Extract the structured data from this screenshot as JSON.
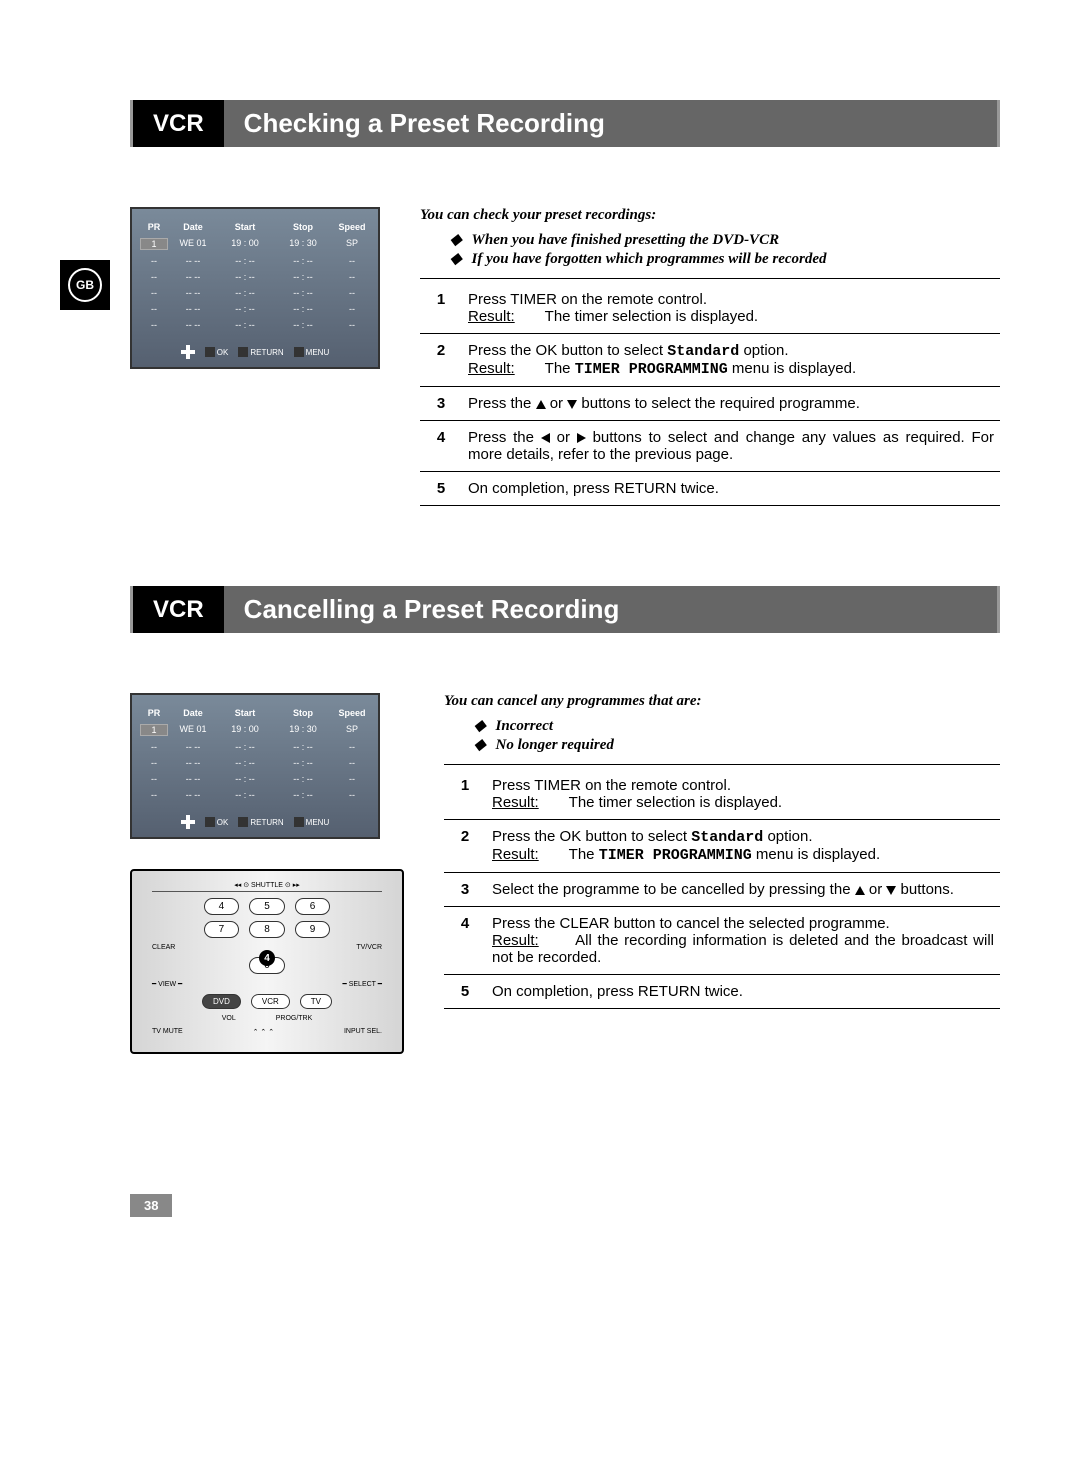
{
  "gb_label": "GB",
  "section1": {
    "vcr_tag": "VCR",
    "title": "Checking a Preset Recording",
    "osd": {
      "headers": [
        "PR",
        "Date",
        "Start",
        "Stop",
        "Speed"
      ],
      "row1": [
        "1",
        "WE  01",
        "19 : 00",
        "19 : 30",
        "SP"
      ],
      "blank": [
        "--",
        "--  --",
        "-- : --",
        "-- : --",
        "--"
      ],
      "footer": {
        "ok": "OK",
        "return": "RETURN",
        "menu": "MENU"
      }
    },
    "intro": "You can check your preset recordings:",
    "bullets": [
      "When you have finished presetting the DVD-VCR",
      "If you have forgotten which programmes will be recorded"
    ],
    "steps": [
      {
        "n": "1",
        "text": "Press TIMER on the remote control.",
        "result_label": "Result",
        "result": "The timer selection is displayed."
      },
      {
        "n": "2",
        "text": "Press the OK button to select ",
        "mono": "Standard",
        "text2": " option.",
        "result_label": "Result",
        "result_prefix": "The ",
        "result_mono": "TIMER PROGRAMMING",
        "result_suffix": " menu is displayed."
      },
      {
        "n": "3",
        "text_full": "Press the ▲ or ▼ buttons to select the required programme."
      },
      {
        "n": "4",
        "text_full": "Press the ◀ or ▶ buttons to select and change any values as required. For more details, refer to the previous page."
      },
      {
        "n": "5",
        "text_full": "On completion, press RETURN twice."
      }
    ]
  },
  "section2": {
    "vcr_tag": "VCR",
    "title": "Cancelling a Preset Recording",
    "intro": "You can cancel any programmes that are:",
    "bullets": [
      "Incorrect",
      "No longer required"
    ],
    "steps": [
      {
        "n": "1",
        "text": "Press TIMER on the remote control.",
        "result_label": "Result",
        "result": "The timer selection is displayed."
      },
      {
        "n": "2",
        "text": "Press the OK button to select ",
        "mono": "Standard",
        "text2": " option.",
        "result_label": "Result",
        "result_prefix": "The ",
        "result_mono": "TIMER PROGRAMMING",
        "result_suffix": " menu is displayed."
      },
      {
        "n": "3",
        "text_full": "Select the programme to be cancelled by pressing the ▲ or ▼ buttons."
      },
      {
        "n": "4",
        "text": "Press the CLEAR button to cancel the selected programme.",
        "result_label": "Result",
        "result": "All the recording information is deleted and the broadcast will not be recorded."
      },
      {
        "n": "5",
        "text_full": "On completion, press RETURN twice."
      }
    ],
    "remote": {
      "shuttle": "SHUTTLE",
      "nums_row1": [
        "4",
        "5",
        "6"
      ],
      "nums_row2": [
        "7",
        "8",
        "9"
      ],
      "clear": "CLEAR",
      "tvvcr": "TV/VCR",
      "zero": "0",
      "callout": "4",
      "view": "VIEW",
      "select": "SELECT",
      "dvd": "DVD",
      "vcr": "VCR",
      "tv": "TV",
      "vol": "VOL",
      "prog": "PROG/TRK",
      "tvmute": "TV MUTE",
      "inputsel": "INPUT SEL."
    }
  },
  "page_number": "38"
}
